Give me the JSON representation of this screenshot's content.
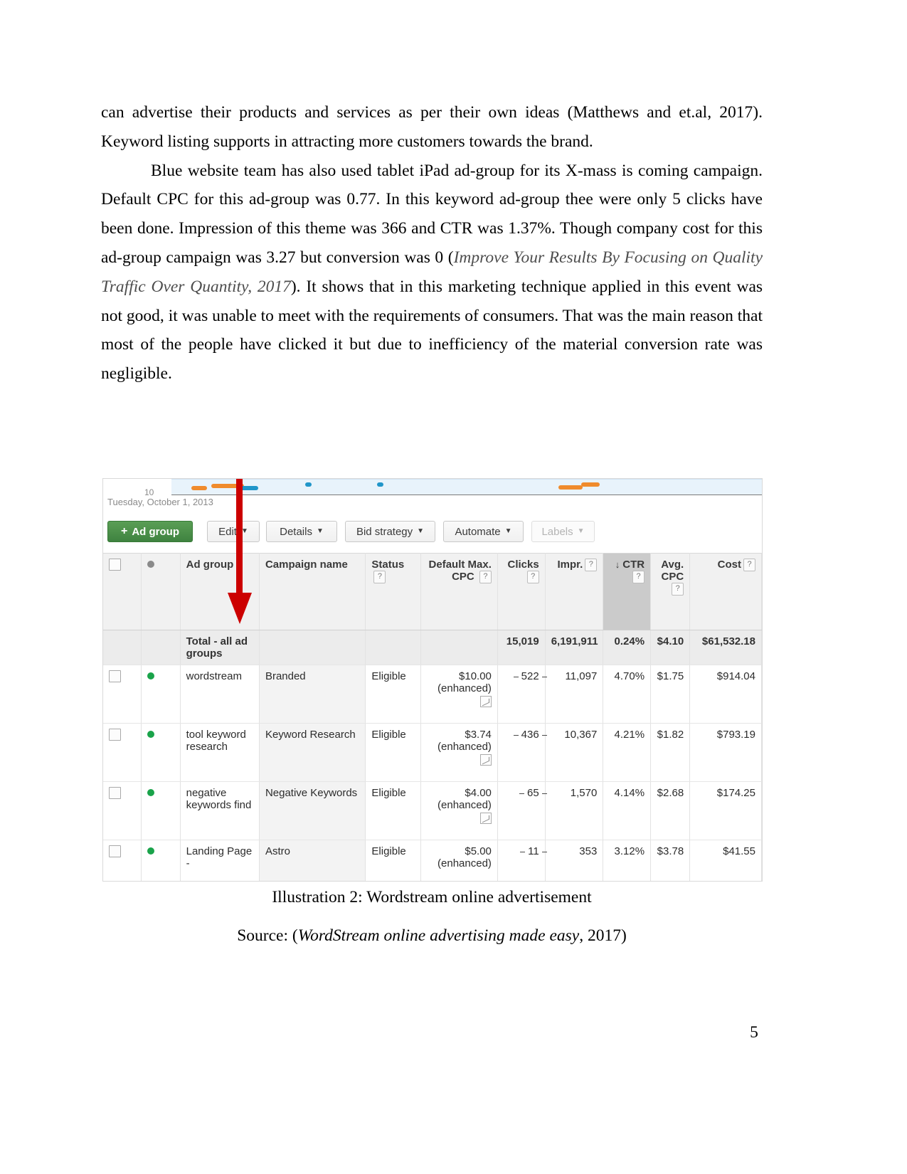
{
  "document": {
    "page_number": "5",
    "paragraphs": [
      {
        "indent": false,
        "runs": [
          {
            "text": "can advertise their products and services as per their own ideas (Matthews and et.al, 2017). Keyword listing supports in attracting more customers towards the brand.",
            "style": "normal"
          }
        ]
      },
      {
        "indent": true,
        "runs": [
          {
            "text": "Blue website team has also used tablet iPad ad-group for its X-mass is coming campaign. Default CPC for this ad-group was 0.77. In this keyword ad-group thee were only 5 clicks have been done. Impression of this theme was 366 and CTR was 1.37%. Though company cost for this ad-group campaign was 3.27 but conversion was 0 (",
            "style": "normal"
          },
          {
            "text": "Improve Your Results By Focusing on Quality Traffic Over Quantity",
            "style": "italic"
          },
          {
            "text": ", 2017",
            "style": "italic-plain"
          },
          {
            "text": "). It shows that in this marketing technique applied in this event was not good, it was unable to meet with the requirements of consumers. That was the main reason that most of the people have clicked it but due to inefficiency of the material conversion rate was negligible.",
            "style": "normal"
          }
        ]
      }
    ],
    "caption": "Illustration 2: Wordstream online advertisement",
    "source_prefix": "Source: (",
    "source_italic": "WordStream online advertising made easy",
    "source_suffix": ", 2017)"
  },
  "figure": {
    "chart": {
      "y_tick_label": "10",
      "date_label": "Tuesday, October 1, 2013"
    },
    "toolbar": {
      "add_ad_group": "Ad group",
      "edit": "Edit",
      "details": "Details",
      "bid_strategy": "Bid strategy",
      "automate": "Automate",
      "labels": "Labels"
    },
    "table": {
      "columns": [
        {
          "label": "",
          "help": false,
          "align": "left"
        },
        {
          "label": "",
          "help": false,
          "align": "left"
        },
        {
          "label": "Ad group",
          "help": false,
          "align": "left"
        },
        {
          "label": "Campaign name",
          "help": false,
          "align": "left"
        },
        {
          "label": "Status",
          "help": true,
          "align": "left"
        },
        {
          "label": "Default Max. CPC",
          "help": true,
          "align": "right"
        },
        {
          "label": "Clicks",
          "help": true,
          "align": "right"
        },
        {
          "label": "Impr.",
          "help": true,
          "align": "right"
        },
        {
          "label": "CTR",
          "help": true,
          "align": "right",
          "sorted": true,
          "sort_dir": "desc"
        },
        {
          "label": "Avg. CPC",
          "help": true,
          "align": "right"
        },
        {
          "label": "Cost",
          "help": true,
          "align": "right"
        }
      ],
      "total_row": {
        "name": "Total - all ad groups",
        "clicks": "15,019",
        "impr": "6,191,911",
        "ctr": "0.24%",
        "avg_cpc": "$4.10",
        "cost": "$61,532.18"
      },
      "rows": [
        {
          "ad_group": "wordstream",
          "campaign": "Branded",
          "status": "Eligible",
          "max_cpc": "$10.00",
          "max_cpc_note": "(enhanced)",
          "clicks": "522",
          "impr": "11,097",
          "ctr": "4.70%",
          "avg_cpc": "$1.75",
          "cost": "$914.04"
        },
        {
          "ad_group": "tool keyword research",
          "campaign": "Keyword Research",
          "status": "Eligible",
          "max_cpc": "$3.74",
          "max_cpc_note": "(enhanced)",
          "clicks": "436",
          "impr": "10,367",
          "ctr": "4.21%",
          "avg_cpc": "$1.82",
          "cost": "$793.19"
        },
        {
          "ad_group": "negative keywords find",
          "campaign": "Negative Keywords",
          "status": "Eligible",
          "max_cpc": "$4.00",
          "max_cpc_note": "(enhanced)",
          "clicks": "65",
          "impr": "1,570",
          "ctr": "4.14%",
          "avg_cpc": "$2.68",
          "cost": "$174.25"
        },
        {
          "ad_group": "Landing Page -",
          "campaign": "Astro",
          "status": "Eligible",
          "max_cpc": "$5.00",
          "max_cpc_note": "(enhanced)",
          "clicks": "11",
          "impr": "353",
          "ctr": "3.12%",
          "avg_cpc": "$3.78",
          "cost": "$41.55"
        }
      ]
    },
    "annotation": {
      "arrow_color": "#cc0000"
    }
  }
}
